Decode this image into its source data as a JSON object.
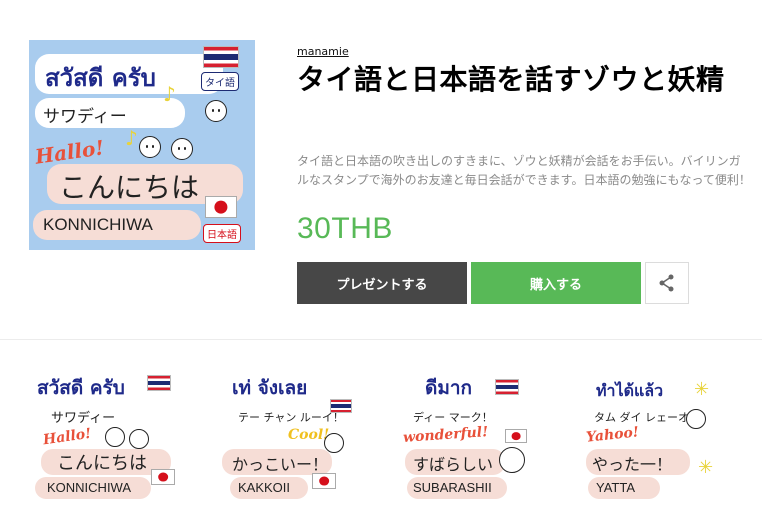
{
  "product": {
    "author": "manamie",
    "title": "タイ語と日本語を話すゾウと妖精",
    "description": "タイ語と日本語の吹き出しのすきまに、ゾウと妖精が会話をお手伝い。バイリンガルなスタンプで海外のお友達と毎日会話ができます。日本語の勉強にもなって便利！",
    "price": "30THB"
  },
  "actions": {
    "gift_label": "プレゼントする",
    "buy_label": "購入する",
    "share_icon": "share-icon"
  },
  "main_image": {
    "thai_text": "สวัสดี ครับ",
    "thai_tag": "タイ語",
    "katakana": "サワディー",
    "hello": "Hallo!",
    "hiragana": "こんにちは",
    "romaji": "KONNICHIWA",
    "jp_tag": "日本語"
  },
  "stickers": [
    {
      "thai": "สวัสดี ครับ",
      "line2": "サワディー",
      "exclaim": "Hallo!",
      "jp": "こんにちは",
      "romaji": "KONNICHIWA"
    },
    {
      "thai": "เท่ จังเลย",
      "line2": "テー チャン ルーイ！",
      "exclaim": "Cool!",
      "jp": "かっこいー！",
      "romaji": "KAKKOII"
    },
    {
      "thai": "ดีมาก",
      "line2": "ディー マーク！",
      "exclaim": "wonderful!",
      "jp": "すばらしい",
      "romaji": "SUBARASHII"
    },
    {
      "thai": "ทำได้แล้ว",
      "line2": "タム ダイ レェーオ！",
      "exclaim": "Yahoo!",
      "jp": "やった一！",
      "romaji": "YATTA"
    }
  ],
  "colors": {
    "price": "#58b957",
    "buy_button": "#58b957",
    "gift_button": "#474747",
    "thumb_bg": "#a9ccee"
  }
}
